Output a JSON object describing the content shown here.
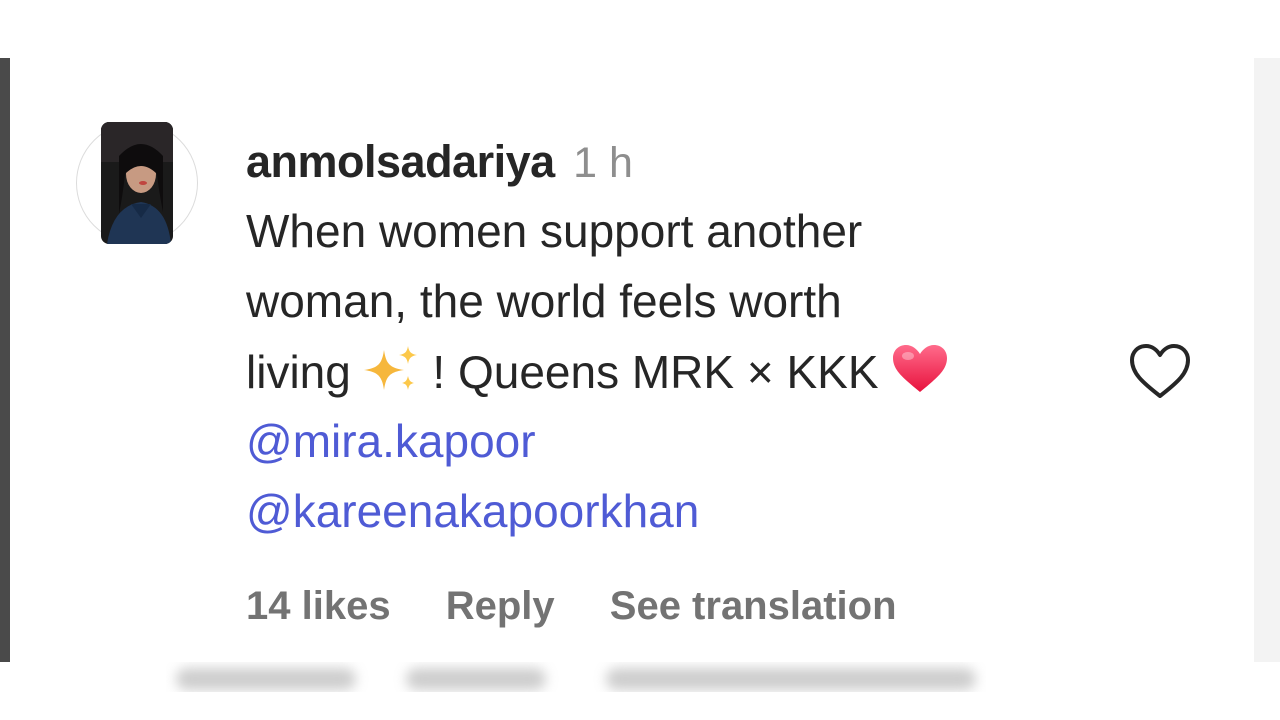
{
  "comment": {
    "username": "anmolsadariya",
    "timestamp": "1 h",
    "text_line1": "When women support another",
    "text_line2": "woman, the world feels worth",
    "text_line3_start": "living",
    "text_line3_middle": "! Queens MRK × KKK",
    "mentions": [
      "@mira.kapoor",
      "@kareenakapoorkhan"
    ],
    "likes": "14 likes",
    "reply_label": "Reply",
    "translate_label": "See translation"
  },
  "icons": {
    "sparkles": "sparkles-emoji",
    "heart_emoji": "red-heart-emoji",
    "like": "heart-outline-icon"
  },
  "colors": {
    "mention": "#4f5bd5",
    "username": "#262626",
    "secondary": "#8e8e8e",
    "actions": "#737373"
  }
}
